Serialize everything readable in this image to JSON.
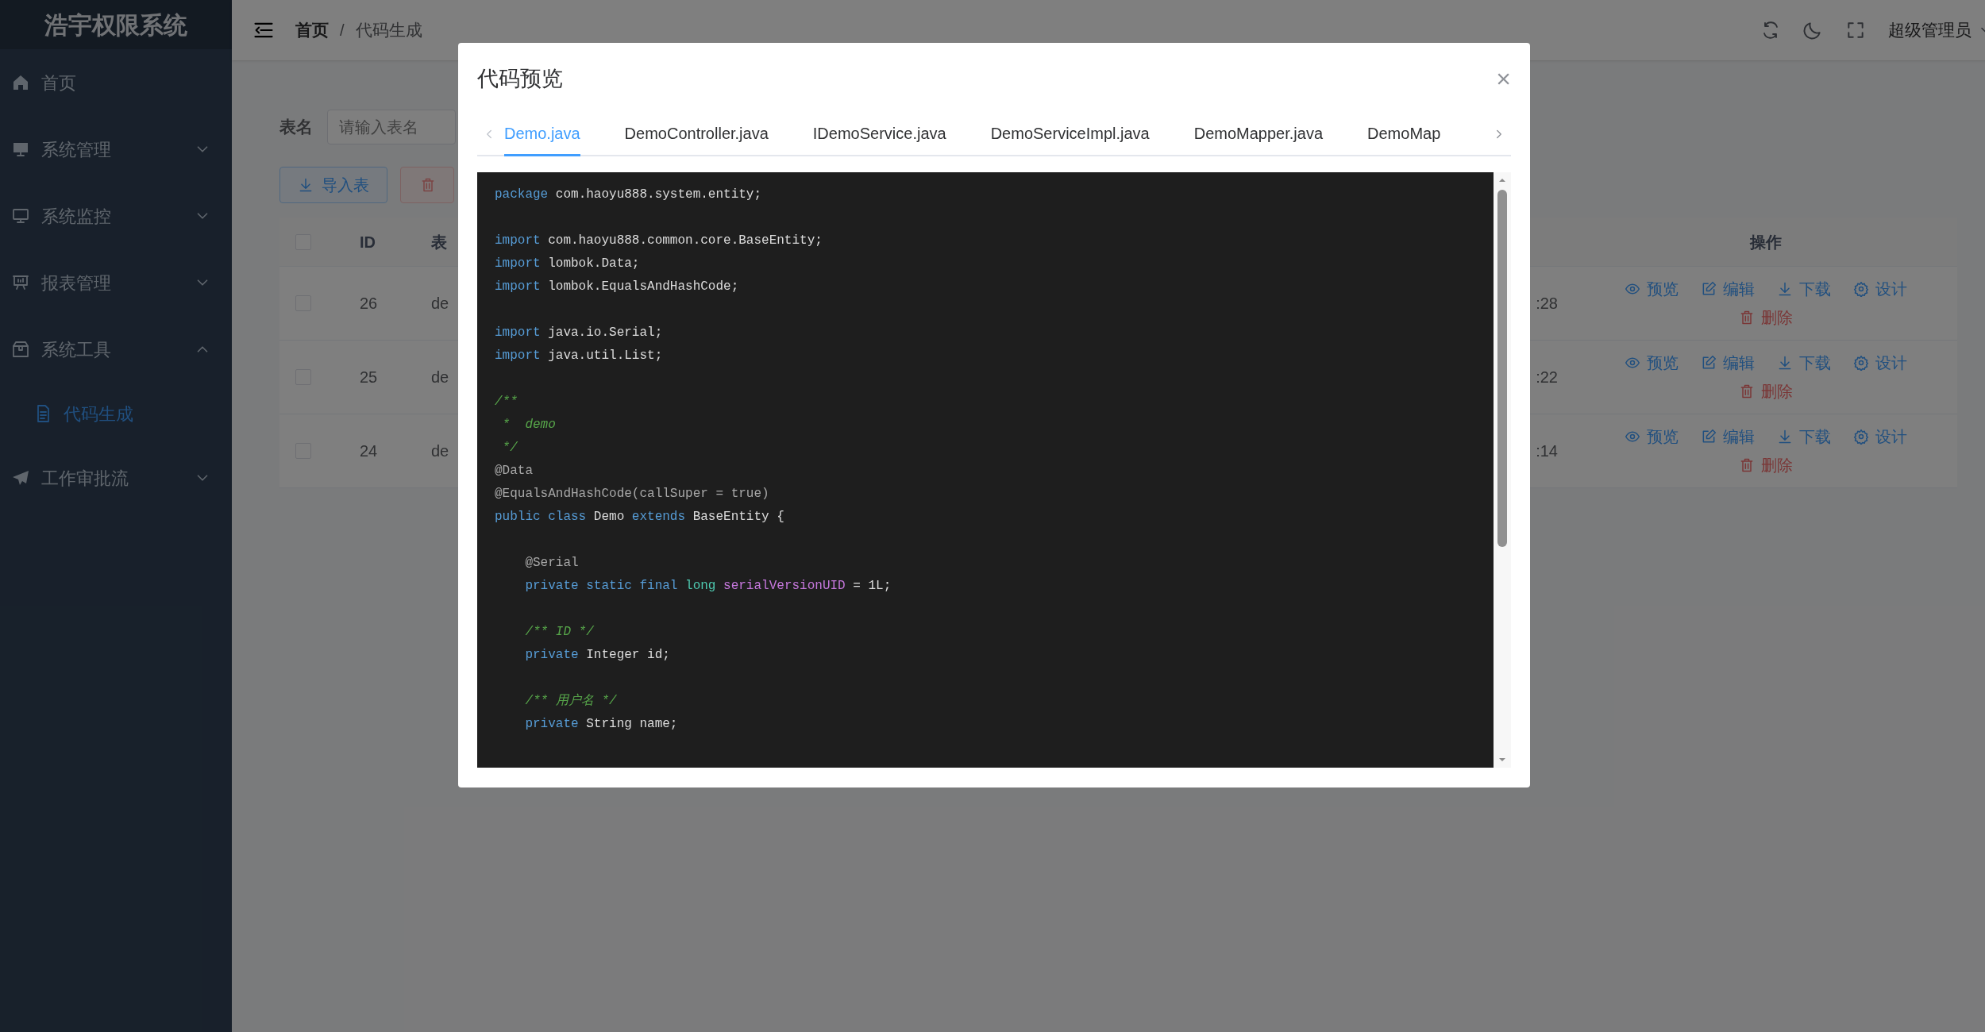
{
  "sidebar": {
    "logo": "浩宇权限系统",
    "items": [
      {
        "label": "首页",
        "kind": "link",
        "selected": false
      },
      {
        "label": "系统管理",
        "kind": "group",
        "expanded": false,
        "selected": false
      },
      {
        "label": "系统监控",
        "kind": "group",
        "expanded": false,
        "selected": false
      },
      {
        "label": "报表管理",
        "kind": "group",
        "expanded": false,
        "selected": false
      },
      {
        "label": "系统工具",
        "kind": "group",
        "expanded": true,
        "selected": false,
        "children": [
          {
            "label": "代码生成",
            "selected": true
          }
        ]
      },
      {
        "label": "工作审批流",
        "kind": "group",
        "expanded": false,
        "selected": false
      }
    ]
  },
  "header": {
    "breadcrumb": [
      "首页",
      "代码生成"
    ],
    "separator": "/",
    "user": "超级管理员"
  },
  "search": {
    "label": "表名",
    "placeholder": "请输入表名"
  },
  "toolbar": [
    {
      "label": "导入表",
      "kind": "import"
    },
    {
      "kind": "delete"
    }
  ],
  "table": {
    "select_all_checked": false,
    "columns": [
      "ID",
      "表",
      "操作"
    ],
    "rows": [
      {
        "id": "26",
        "name": "de",
        "time": ":28",
        "checked": false,
        "actions": [
          {
            "label": "预览",
            "kind": "preview"
          },
          {
            "label": "编辑",
            "kind": "edit"
          },
          {
            "label": "下载",
            "kind": "download"
          },
          {
            "label": "设计",
            "kind": "design"
          },
          {
            "label": "删除",
            "kind": "delete"
          }
        ]
      },
      {
        "id": "25",
        "name": "de",
        "time": ":22",
        "checked": false,
        "actions": [
          {
            "label": "预览",
            "kind": "preview"
          },
          {
            "label": "编辑",
            "kind": "edit"
          },
          {
            "label": "下载",
            "kind": "download"
          },
          {
            "label": "设计",
            "kind": "design"
          },
          {
            "label": "删除",
            "kind": "delete"
          }
        ]
      },
      {
        "id": "24",
        "name": "de",
        "time": ":14",
        "checked": false,
        "actions": [
          {
            "label": "预览",
            "kind": "preview"
          },
          {
            "label": "编辑",
            "kind": "edit"
          },
          {
            "label": "下载",
            "kind": "download"
          },
          {
            "label": "设计",
            "kind": "design"
          },
          {
            "label": "删除",
            "kind": "delete"
          }
        ]
      }
    ]
  },
  "dialog": {
    "title": "代码预览",
    "close": "×",
    "tabs": [
      {
        "label": "Demo.java",
        "selected": true
      },
      {
        "label": "DemoController.java",
        "selected": false
      },
      {
        "label": "IDemoService.java",
        "selected": false
      },
      {
        "label": "DemoServiceImpl.java",
        "selected": false
      },
      {
        "label": "DemoMapper.java",
        "selected": false
      },
      {
        "label": "DemoMap",
        "selected": false
      }
    ],
    "code": [
      {
        "kind": "code",
        "segments": [
          {
            "kind": "keyword",
            "text": "package"
          },
          {
            "kind": "plain",
            "text": " com.haoyu888.system.entity;"
          }
        ]
      },
      {
        "kind": "blank"
      },
      {
        "kind": "code",
        "segments": [
          {
            "kind": "keyword",
            "text": "import"
          },
          {
            "kind": "plain",
            "text": " com.haoyu888.common.core.BaseEntity;"
          }
        ]
      },
      {
        "kind": "code",
        "segments": [
          {
            "kind": "keyword",
            "text": "import"
          },
          {
            "kind": "plain",
            "text": " lombok.Data;"
          }
        ]
      },
      {
        "kind": "code",
        "segments": [
          {
            "kind": "keyword",
            "text": "import"
          },
          {
            "kind": "plain",
            "text": " lombok.EqualsAndHashCode;"
          }
        ]
      },
      {
        "kind": "blank"
      },
      {
        "kind": "code",
        "segments": [
          {
            "kind": "keyword",
            "text": "import"
          },
          {
            "kind": "plain",
            "text": " java.io.Serial;"
          }
        ]
      },
      {
        "kind": "code",
        "segments": [
          {
            "kind": "keyword",
            "text": "import"
          },
          {
            "kind": "plain",
            "text": " java.util.List;"
          }
        ]
      },
      {
        "kind": "blank"
      },
      {
        "kind": "code",
        "segments": [
          {
            "kind": "comment",
            "text": "/**"
          }
        ]
      },
      {
        "kind": "code",
        "segments": [
          {
            "kind": "comment",
            "text": " *  demo"
          }
        ]
      },
      {
        "kind": "code",
        "segments": [
          {
            "kind": "comment",
            "text": " */"
          }
        ]
      },
      {
        "kind": "code",
        "segments": [
          {
            "kind": "annotation",
            "text": "@Data"
          }
        ]
      },
      {
        "kind": "code",
        "segments": [
          {
            "kind": "annotation",
            "text": "@EqualsAndHashCode(callSuper = true)"
          }
        ]
      },
      {
        "kind": "code",
        "segments": [
          {
            "kind": "keyword",
            "text": "public class"
          },
          {
            "kind": "plain",
            "text": " Demo "
          },
          {
            "kind": "keyword",
            "text": "extends"
          },
          {
            "kind": "plain",
            "text": " BaseEntity {"
          }
        ]
      },
      {
        "kind": "blank"
      },
      {
        "kind": "code",
        "segments": [
          {
            "kind": "annotation",
            "text": "    @Serial"
          }
        ]
      },
      {
        "kind": "code",
        "segments": [
          {
            "kind": "keyword",
            "text": "    private static final "
          },
          {
            "kind": "type",
            "text": "long "
          },
          {
            "kind": "field",
            "text": "serialVersionUID"
          },
          {
            "kind": "plain",
            "text": " = 1L;"
          }
        ]
      },
      {
        "kind": "blank"
      },
      {
        "kind": "code",
        "segments": [
          {
            "kind": "comment",
            "text": "    /** ID */"
          }
        ]
      },
      {
        "kind": "code",
        "segments": [
          {
            "kind": "keyword",
            "text": "    private"
          },
          {
            "kind": "plain",
            "text": " Integer id;"
          }
        ]
      },
      {
        "kind": "blank"
      },
      {
        "kind": "code",
        "segments": [
          {
            "kind": "comment",
            "text": "    /** 用户名 */"
          }
        ]
      },
      {
        "kind": "code",
        "segments": [
          {
            "kind": "keyword",
            "text": "    private"
          },
          {
            "kind": "plain",
            "text": " String name;"
          }
        ]
      }
    ]
  }
}
